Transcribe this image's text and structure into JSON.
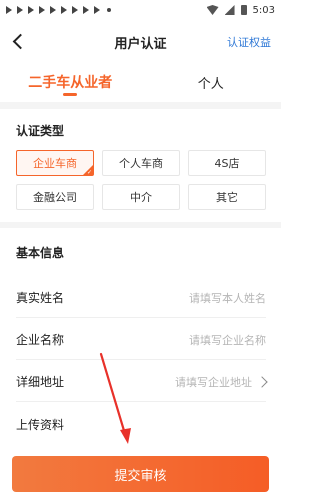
{
  "status_bar": {
    "time": "5:03"
  },
  "header": {
    "title": "用户认证",
    "rights_link": "认证权益"
  },
  "tabs": [
    {
      "label": "二手车从业者",
      "active": true
    },
    {
      "label": "个人",
      "active": false
    }
  ],
  "cert_type": {
    "title": "认证类型",
    "options": [
      {
        "label": "企业车商",
        "selected": true
      },
      {
        "label": "个人车商",
        "selected": false
      },
      {
        "label": "4S店",
        "selected": false
      },
      {
        "label": "金融公司",
        "selected": false
      },
      {
        "label": "中介",
        "selected": false
      },
      {
        "label": "其它",
        "selected": false
      }
    ]
  },
  "basic_info": {
    "title": "基本信息",
    "fields": [
      {
        "label": "真实姓名",
        "placeholder": "请填写本人姓名"
      },
      {
        "label": "企业名称",
        "placeholder": "请填写企业名称"
      },
      {
        "label": "详细地址",
        "placeholder": "请填写企业地址"
      },
      {
        "label": "上传资料",
        "placeholder": ""
      }
    ]
  },
  "submit": {
    "label": "提交审核"
  },
  "colors": {
    "accent": "#f5652b",
    "link": "#2f78d6",
    "annotation_arrow": "#e8312a"
  }
}
